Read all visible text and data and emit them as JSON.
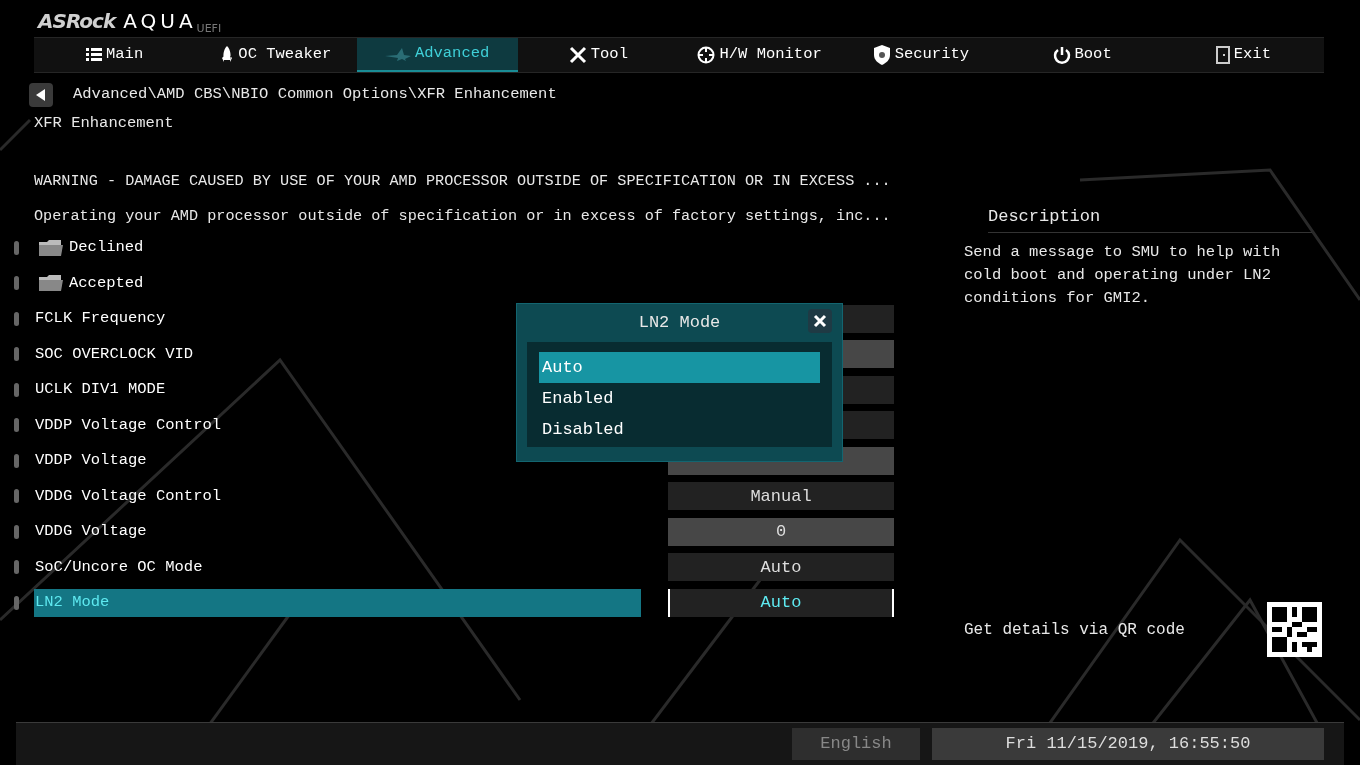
{
  "logo": {
    "brand": "ASRock",
    "product": "AQUA",
    "suffix": "UEFI"
  },
  "tabs": [
    {
      "label": "Main",
      "selected": false
    },
    {
      "label": "OC Tweaker",
      "selected": false
    },
    {
      "label": "Advanced",
      "selected": true
    },
    {
      "label": "Tool",
      "selected": false
    },
    {
      "label": "H/W Monitor",
      "selected": false
    },
    {
      "label": "Security",
      "selected": false
    },
    {
      "label": "Boot",
      "selected": false
    },
    {
      "label": "Exit",
      "selected": false
    }
  ],
  "breadcrumb": "Advanced\\AMD CBS\\NBIO Common Options\\XFR Enhancement",
  "page_title": "XFR Enhancement",
  "warnings": [
    "WARNING - DAMAGE CAUSED BY USE OF YOUR AMD PROCESSOR OUTSIDE OF SPECIFICATION OR IN EXCESS ...",
    "Operating your AMD processor outside of specification or in excess of factory settings, inc..."
  ],
  "items": [
    {
      "kind": "folder",
      "label": "Declined",
      "selected": false
    },
    {
      "kind": "folder",
      "label": "Accepted",
      "selected": false
    },
    {
      "kind": "option",
      "label": "FCLK Frequency",
      "selected": false
    },
    {
      "kind": "number",
      "label": "SOC OVERCLOCK VID",
      "selected": false
    },
    {
      "kind": "option",
      "label": "UCLK DIV1 MODE",
      "selected": false
    },
    {
      "kind": "option",
      "label": "VDDP Voltage Control",
      "selected": false
    },
    {
      "kind": "number",
      "label": "VDDP Voltage",
      "selected": false
    },
    {
      "kind": "option",
      "label": "VDDG Voltage Control",
      "value": "Manual",
      "selected": false
    },
    {
      "kind": "number",
      "label": "VDDG Voltage",
      "value": "0",
      "selected": false
    },
    {
      "kind": "option",
      "label": "SoC/Uncore OC Mode",
      "value": "Auto",
      "selected": false
    },
    {
      "kind": "option",
      "label": "LN2 Mode",
      "value": "Auto",
      "selected": true
    }
  ],
  "popup": {
    "title": "LN2 Mode",
    "options": [
      {
        "label": "Auto",
        "selected": true
      },
      {
        "label": "Enabled",
        "selected": false
      },
      {
        "label": "Disabled",
        "selected": false
      }
    ]
  },
  "description": {
    "heading": "Description",
    "text": "Send a message to SMU to help with cold boot and operating under LN2 conditions for GMI2.",
    "qr_hint": "Get details via QR code"
  },
  "status_bar": {
    "language": "English",
    "datetime": "Fri 11/15/2019, 16:55:50"
  }
}
